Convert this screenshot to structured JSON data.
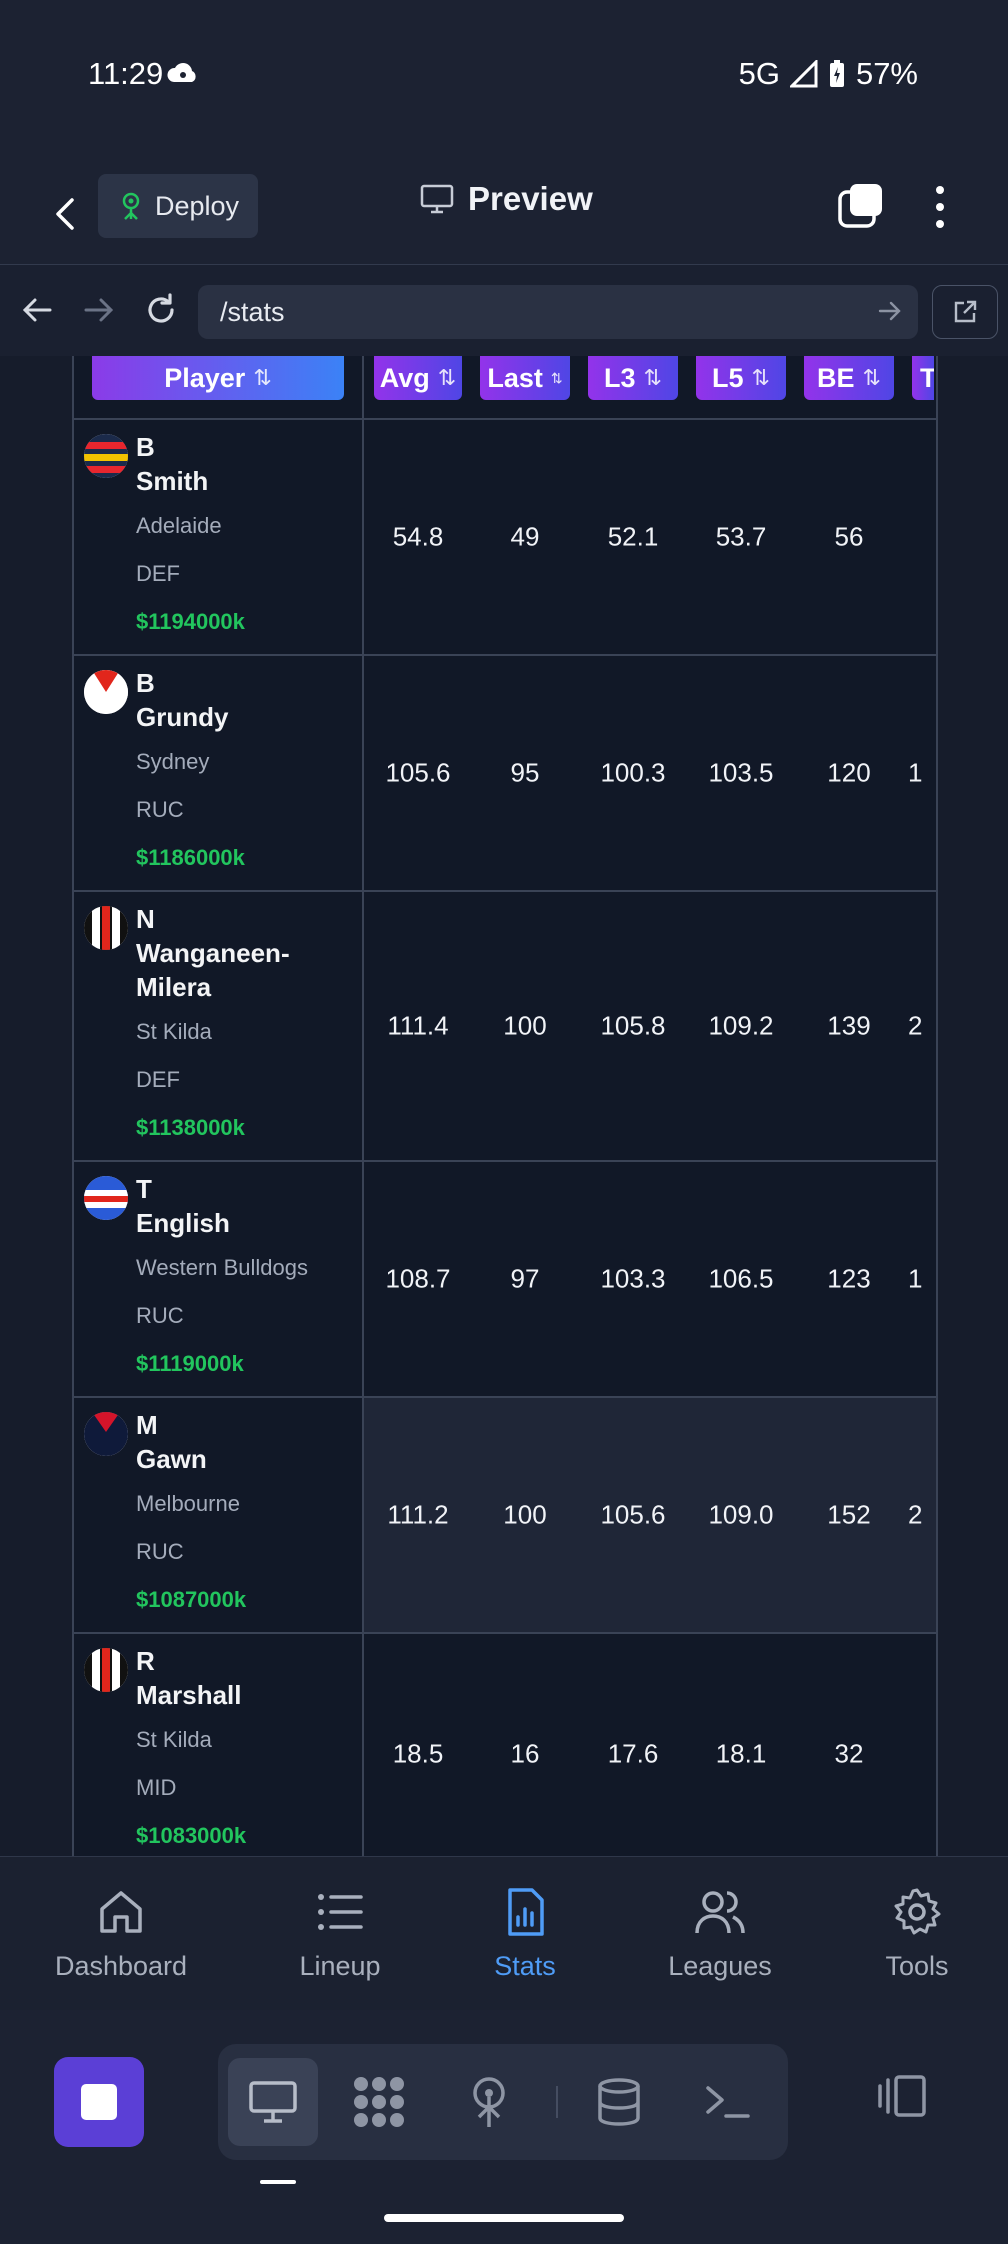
{
  "status_bar": {
    "time": "11:29",
    "network": "5G",
    "battery": "57%"
  },
  "app_bar": {
    "deploy_label": "Deploy",
    "title": "Preview"
  },
  "url_bar": {
    "path": "/stats"
  },
  "table": {
    "headers": {
      "player": "Player",
      "avg": "Avg",
      "last": "Last",
      "l3": "L3",
      "l5": "L5",
      "be": "BE",
      "t": "T"
    },
    "rows": [
      {
        "first": "B",
        "last": "Smith",
        "team": "Adelaide",
        "pos": "DEF",
        "price": "$1194000k",
        "avg": "54.8",
        "last_score": "49",
        "l3": "52.1",
        "l5": "53.7",
        "be": "56",
        "t": ""
      },
      {
        "first": "B",
        "last": "Grundy",
        "team": "Sydney",
        "pos": "RUC",
        "price": "$1186000k",
        "avg": "105.6",
        "last_score": "95",
        "l3": "100.3",
        "l5": "103.5",
        "be": "120",
        "t": "1"
      },
      {
        "first": "N",
        "last": "Wanganeen-Milera",
        "team": "St Kilda",
        "pos": "DEF",
        "price": "$1138000k",
        "avg": "111.4",
        "last_score": "100",
        "l3": "105.8",
        "l5": "109.2",
        "be": "139",
        "t": "2"
      },
      {
        "first": "T",
        "last": "English",
        "team": "Western Bulldogs",
        "pos": "RUC",
        "price": "$1119000k",
        "avg": "108.7",
        "last_score": "97",
        "l3": "103.3",
        "l5": "106.5",
        "be": "123",
        "t": "1"
      },
      {
        "first": "M",
        "last": "Gawn",
        "team": "Melbourne",
        "pos": "RUC",
        "price": "$1087000k",
        "avg": "111.2",
        "last_score": "100",
        "l3": "105.6",
        "l5": "109.0",
        "be": "152",
        "t": "2"
      },
      {
        "first": "R",
        "last": "Marshall",
        "team": "St Kilda",
        "pos": "MID",
        "price": "$1083000k",
        "avg": "18.5",
        "last_score": "16",
        "l3": "17.6",
        "l5": "18.1",
        "be": "32",
        "t": ""
      }
    ]
  },
  "bottom_nav": {
    "dashboard": "Dashboard",
    "lineup": "Lineup",
    "stats": "Stats",
    "leagues": "Leagues",
    "tools": "Tools"
  },
  "colors": {
    "accent": "#4f9cf6",
    "price_green": "#22c55e",
    "header_purple": "#9333ea",
    "stop_button": "#5b3fd6"
  }
}
